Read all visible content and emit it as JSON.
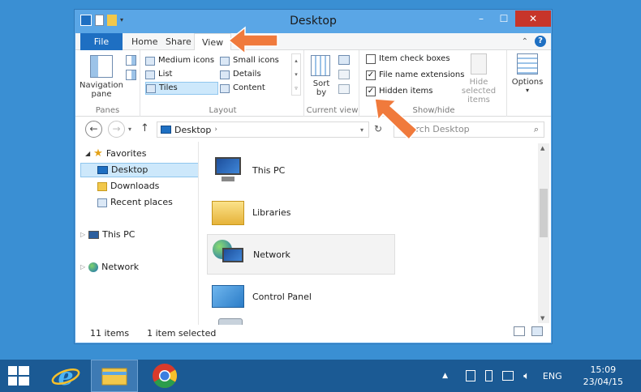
{
  "window": {
    "title": "Desktop",
    "buttons": {
      "minimize": "–",
      "maximize": "☐",
      "close": "✕"
    }
  },
  "ribbon_tabs": {
    "file": "File",
    "home": "Home",
    "share": "Share",
    "view": "View"
  },
  "ribbon": {
    "panes": {
      "navigation_pane": "Navigation pane",
      "label": "Panes"
    },
    "layout": {
      "items": [
        "Medium icons",
        "Small icons",
        "List",
        "Details",
        "Tiles",
        "Content"
      ],
      "selected": "Tiles",
      "label": "Layout"
    },
    "current_view": {
      "sort_by": "Sort by",
      "label": "Current view"
    },
    "show_hide": {
      "item_check_boxes": {
        "label": "Item check boxes",
        "checked": false
      },
      "file_name_extensions": {
        "label": "File name extensions",
        "checked": true
      },
      "hidden_items": {
        "label": "Hidden items",
        "checked": true
      },
      "hide_selected": "Hide selected items",
      "label": "Show/hide"
    },
    "options": "Options"
  },
  "address": {
    "location": "Desktop",
    "search_placeholder": "Search Desktop"
  },
  "nav_pane": {
    "favorites": "Favorites",
    "desktop": "Desktop",
    "downloads": "Downloads",
    "recent_places": "Recent places",
    "this_pc": "This PC",
    "network": "Network"
  },
  "content_items": [
    "This PC",
    "Libraries",
    "Network",
    "Control Panel"
  ],
  "status": {
    "count": "11 items",
    "selected": "1 item selected"
  },
  "taskbar": {
    "language": "ENG",
    "time": "15:09",
    "date": "23/04/15"
  },
  "colors": {
    "desktop_bg": "#3a8fd3",
    "titlebar": "#5aa6e6",
    "accent": "#1e6fc2",
    "close": "#c7352a",
    "taskbar": "#1b5a94",
    "arrow": "#f07a3c"
  }
}
